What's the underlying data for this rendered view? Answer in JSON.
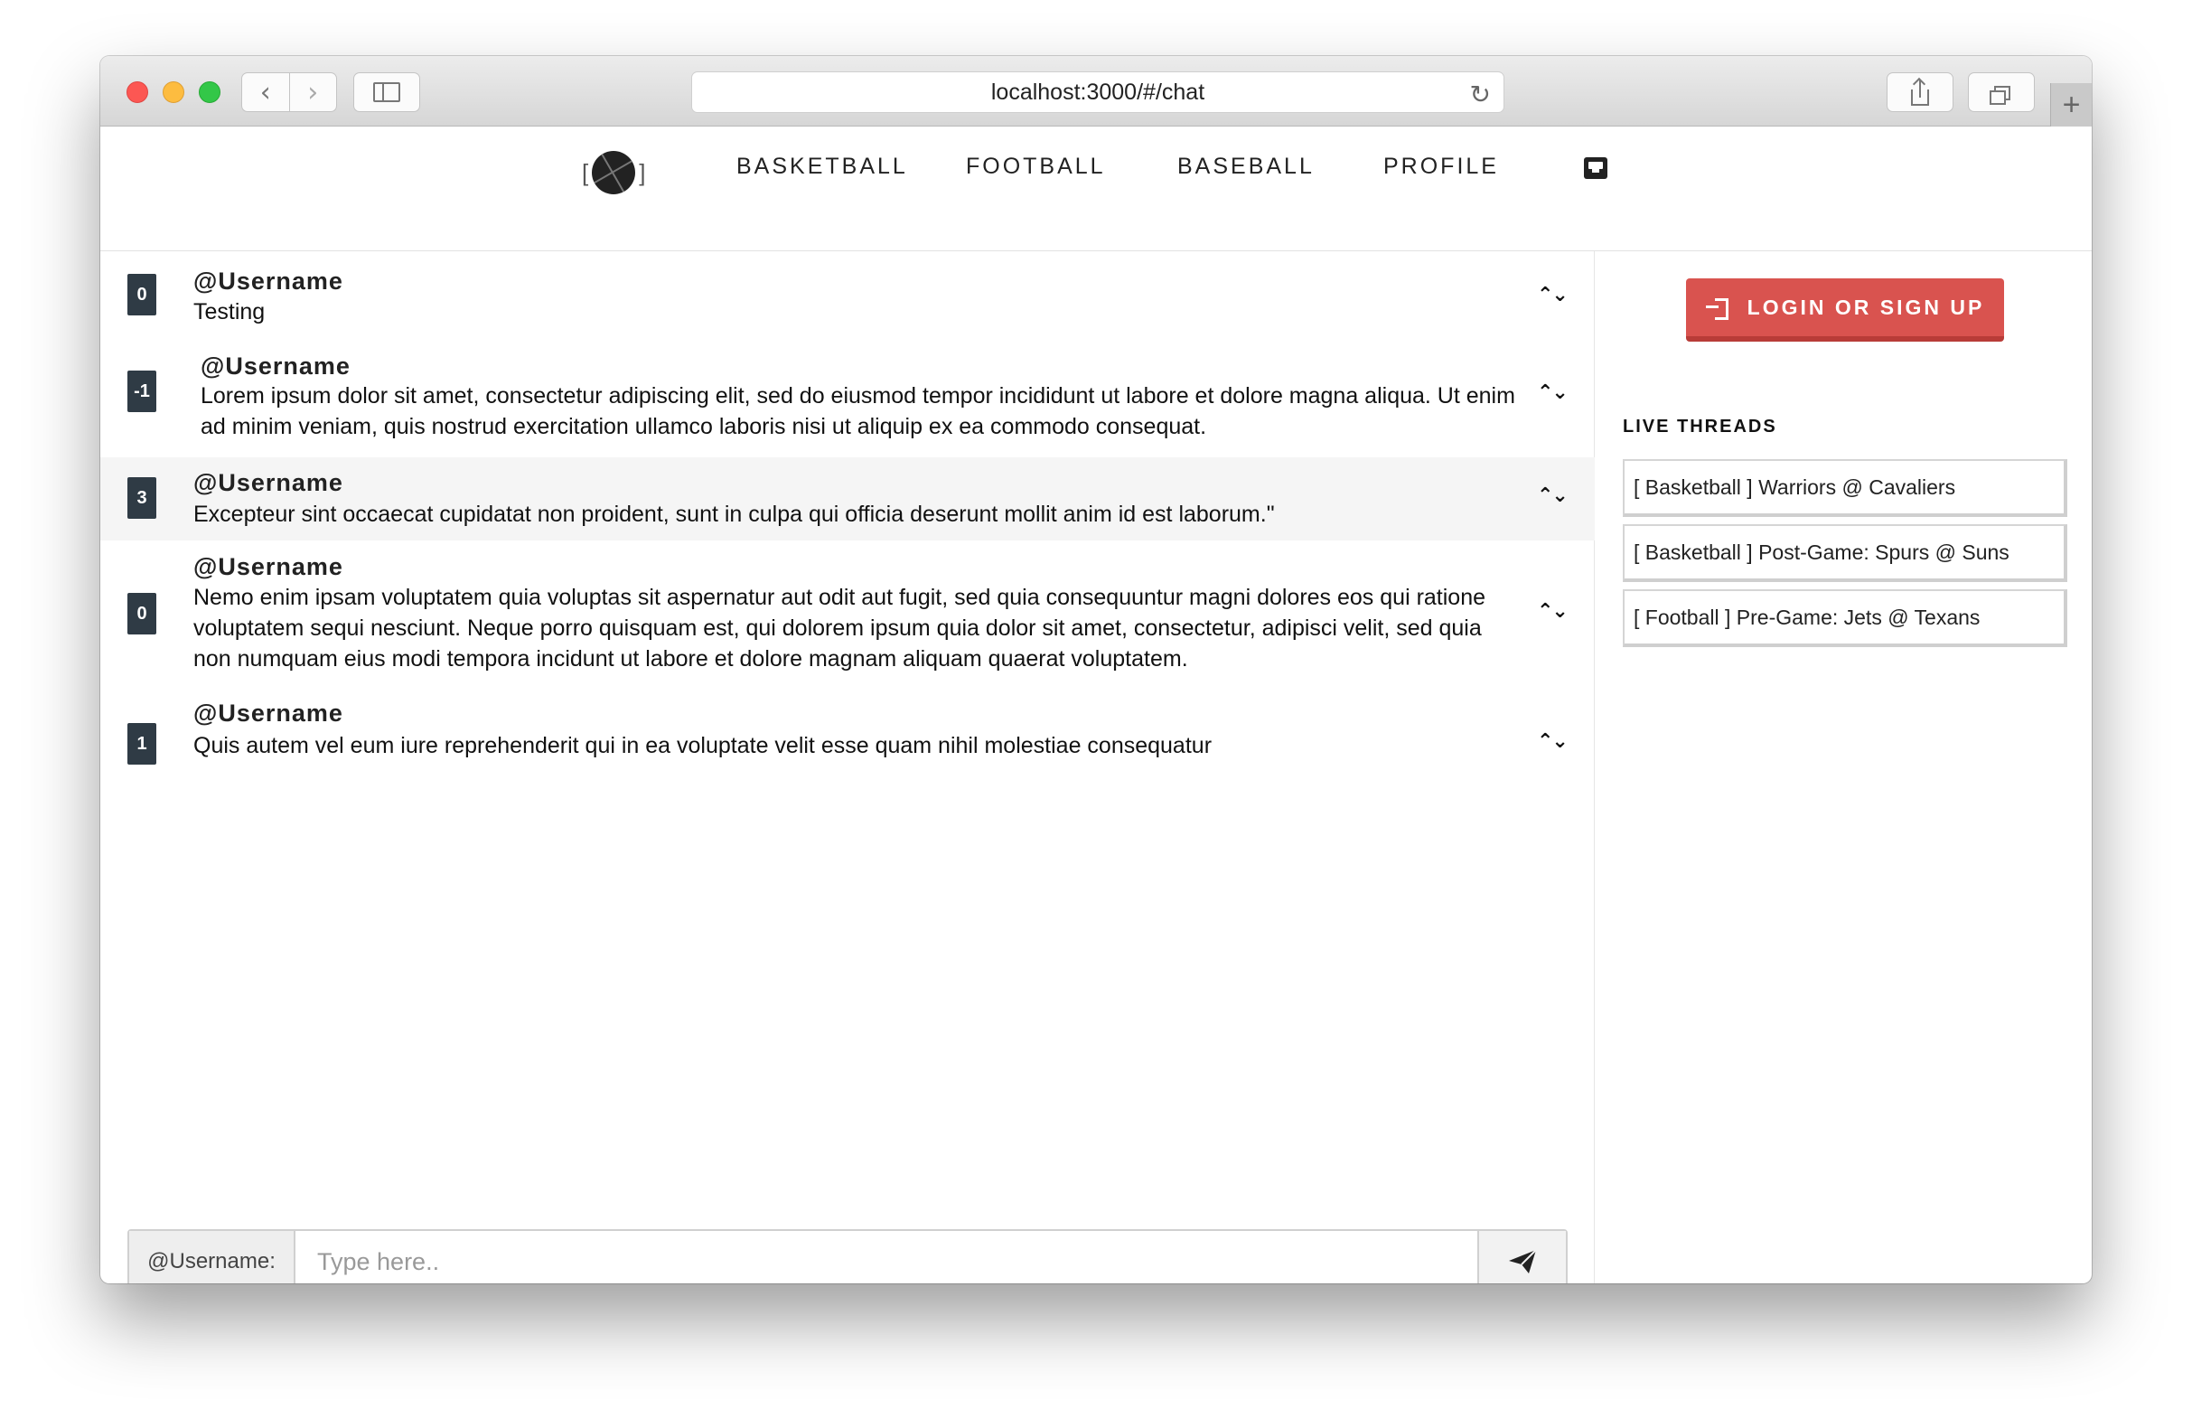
{
  "browser": {
    "url": "localhost:3000/#/chat",
    "back_icon": "chevron-left-icon",
    "forward_icon": "chevron-right-icon",
    "reload_icon": "reload-icon",
    "newtab_label": "+"
  },
  "nav": {
    "logo_left": "[",
    "logo_right": "]",
    "links": [
      "BASKETBALL",
      "FOOTBALL",
      "BASEBALL",
      "PROFILE"
    ],
    "inbox_icon": "inbox-icon"
  },
  "messages": [
    {
      "votes": "0",
      "user": "@Username",
      "text": "Testing"
    },
    {
      "votes": "-1",
      "user": "@Username",
      "text": "Lorem ipsum dolor sit amet, consectetur adipiscing elit, sed do eiusmod tempor incididunt ut labore et dolore magna aliqua. Ut enim ad minim veniam, quis nostrud exercitation ullamco laboris nisi ut aliquip ex ea commodo consequat."
    },
    {
      "votes": "3",
      "user": "@Username",
      "text": "Excepteur sint occaecat cupidatat non proident, sunt in culpa qui officia deserunt mollit anim id est laborum.\""
    },
    {
      "votes": "0",
      "user": "@Username",
      "text": "Nemo enim ipsam voluptatem quia voluptas sit aspernatur aut odit aut fugit, sed quia consequuntur magni dolores eos qui ratione voluptatem sequi nesciunt. Neque porro quisquam est, qui dolorem ipsum quia dolor sit amet, consectetur, adipisci velit, sed quia non numquam eius modi tempora incidunt ut labore et dolore magnam aliquam quaerat voluptatem."
    },
    {
      "votes": "1",
      "user": "@Username",
      "text": "Quis autem vel eum iure reprehenderit qui in ea voluptate velit esse quam nihil molestiae consequatur"
    }
  ],
  "vote_arrows": "^v",
  "composer": {
    "prefix": "@Username:",
    "placeholder": "Type here..",
    "send_icon": "paper-plane-icon"
  },
  "sidebar": {
    "login_label": "LOGIN OR SIGN UP",
    "live_threads_heading": "LIVE THREADS",
    "threads": [
      "[ Basketball ] Warriors @ Cavaliers",
      "[ Basketball ] Post-Game: Spurs @ Suns",
      "[ Football ] Pre-Game: Jets @ Texans"
    ]
  },
  "colors": {
    "accent_red": "#d9534f",
    "vote_badge": "#2f3b45"
  }
}
